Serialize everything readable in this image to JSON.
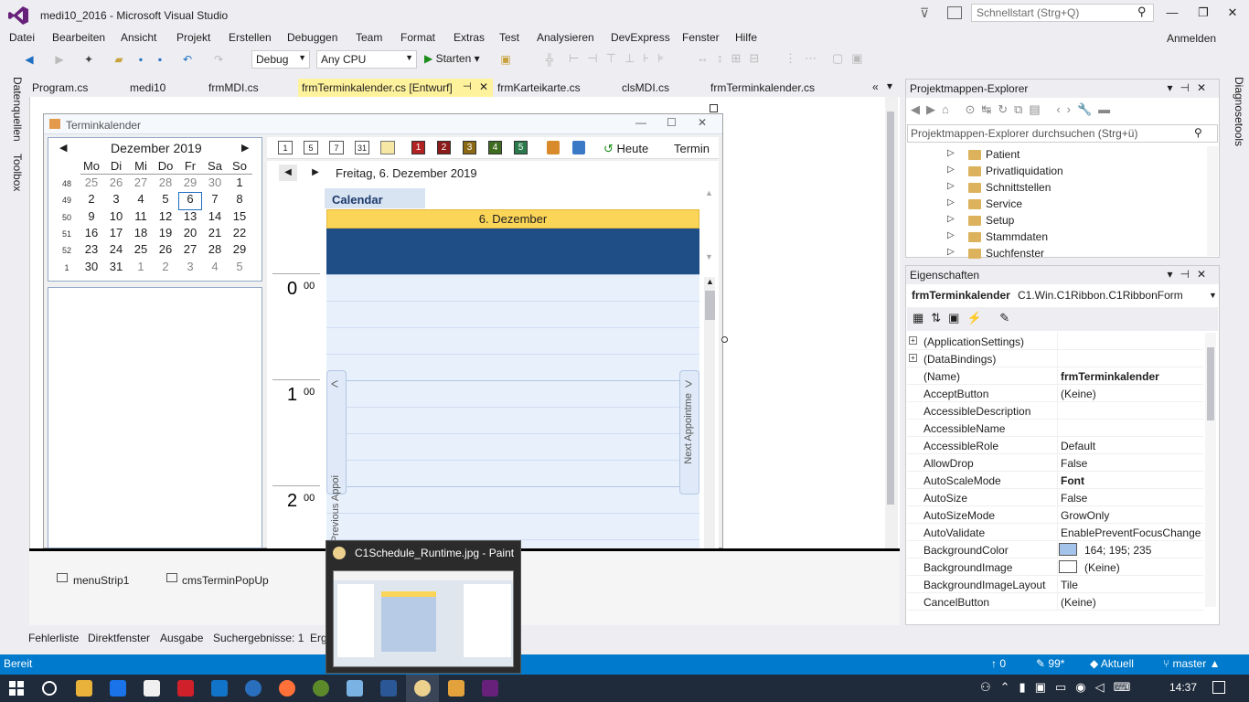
{
  "window": {
    "title": "medi10_2016 - Microsoft Visual Studio",
    "quicklaunch_placeholder": "Schnellstart (Strg+Q)",
    "signin": "Anmelden"
  },
  "menu": [
    "Datei",
    "Bearbeiten",
    "Ansicht",
    "Projekt",
    "Erstellen",
    "Debuggen",
    "Team",
    "Format",
    "Extras",
    "Test",
    "Analysieren",
    "DevExpress",
    "Fenster",
    "Hilfe"
  ],
  "toolbar": {
    "config": "Debug",
    "platform": "Any CPU",
    "start": "Starten"
  },
  "left_tabs": [
    "Datenquellen",
    "Toolbox"
  ],
  "right_tabs": [
    "Diagnosetools"
  ],
  "doc_tabs": [
    "Program.cs",
    "medi10",
    "frmMDI.cs",
    "frmTerminkalender.cs [Entwurf]",
    "frmKarteikarte.cs",
    "clsMDI.cs",
    "frmTerminkalender.cs"
  ],
  "form": {
    "title": "Terminkalender",
    "month_title": "Dezember 2019",
    "weekdays": [
      "Mo",
      "Di",
      "Mi",
      "Do",
      "Fr",
      "Sa",
      "So"
    ],
    "weeks": [
      {
        "wk": "48",
        "days": [
          "25",
          "26",
          "27",
          "28",
          "29",
          "30",
          "1"
        ]
      },
      {
        "wk": "49",
        "days": [
          "2",
          "3",
          "4",
          "5",
          "6",
          "7",
          "8"
        ]
      },
      {
        "wk": "50",
        "days": [
          "9",
          "10",
          "11",
          "12",
          "13",
          "14",
          "15"
        ]
      },
      {
        "wk": "51",
        "days": [
          "16",
          "17",
          "18",
          "19",
          "20",
          "21",
          "22"
        ]
      },
      {
        "wk": "52",
        "days": [
          "23",
          "24",
          "25",
          "26",
          "27",
          "28",
          "29"
        ]
      },
      {
        "wk": "1",
        "days": [
          "30",
          "31",
          "1",
          "2",
          "3",
          "4",
          "5"
        ]
      }
    ],
    "selected_day": "6",
    "sched_toolbar": {
      "view_icons": [
        "1",
        "5",
        "7",
        "31"
      ],
      "color_icons": [
        "1",
        "2",
        "3",
        "4",
        "5"
      ],
      "today": "Heute",
      "appointment": "Termin"
    },
    "date_label": "Freitag, 6. Dezember 2019",
    "calendar_tab": "Calendar",
    "day_header": "6. Dezember",
    "hours": [
      {
        "h": "0",
        "m": "00"
      },
      {
        "h": "1",
        "m": "00"
      },
      {
        "h": "2",
        "m": "00"
      }
    ],
    "prev_btn": "Previous Appoi",
    "next_btn": "Next Appointme"
  },
  "tray": [
    "menuStrip1",
    "cmsTerminPopUp"
  ],
  "bottom_tabs": [
    "Fehlerliste",
    "Direktfenster",
    "Ausgabe",
    "Suchergebnisse: 1",
    "Erg"
  ],
  "solution_explorer": {
    "title": "Projektmappen-Explorer",
    "search_placeholder": "Projektmappen-Explorer durchsuchen (Strg+ü)",
    "items": [
      "Patient",
      "Privatliquidation",
      "Schnittstellen",
      "Service",
      "Setup",
      "Stammdaten",
      "Suchfenster"
    ]
  },
  "properties": {
    "title": "Eigenschaften",
    "object_name": "frmTerminkalender",
    "object_type": "C1.Win.C1Ribbon.C1RibbonForm",
    "rows": [
      {
        "name": "(ApplicationSettings)",
        "value": "",
        "expand": true
      },
      {
        "name": "(DataBindings)",
        "value": "",
        "expand": true
      },
      {
        "name": "(Name)",
        "value": "frmTerminkalender",
        "bold": true
      },
      {
        "name": "AcceptButton",
        "value": "(Keine)"
      },
      {
        "name": "AccessibleDescription",
        "value": ""
      },
      {
        "name": "AccessibleName",
        "value": ""
      },
      {
        "name": "AccessibleRole",
        "value": "Default"
      },
      {
        "name": "AllowDrop",
        "value": "False"
      },
      {
        "name": "AutoScaleMode",
        "value": "Font",
        "bold": true
      },
      {
        "name": "AutoSize",
        "value": "False"
      },
      {
        "name": "AutoSizeMode",
        "value": "GrowOnly"
      },
      {
        "name": "AutoValidate",
        "value": "EnablePreventFocusChange"
      },
      {
        "name": "BackgroundColor",
        "value": "164; 195; 235",
        "swatch": "#a4c3eb"
      },
      {
        "name": "BackgroundImage",
        "value": "(Keine)",
        "swatch": "#ffffff"
      },
      {
        "name": "BackgroundImageLayout",
        "value": "Tile"
      },
      {
        "name": "CancelButton",
        "value": "(Keine)"
      }
    ]
  },
  "status": {
    "ready": "Bereit",
    "up": "0",
    "edits": "99*",
    "branch_state": "Aktuell",
    "branch": "master"
  },
  "thumbnail": {
    "title": "C1Schedule_Runtime.jpg - Paint"
  },
  "taskbar": {
    "time": "14:37"
  },
  "colors": {
    "accent": "#007acc",
    "active_tab": "#fff29d",
    "day_header": "#fbd558",
    "allday_bar": "#1f4e86"
  }
}
